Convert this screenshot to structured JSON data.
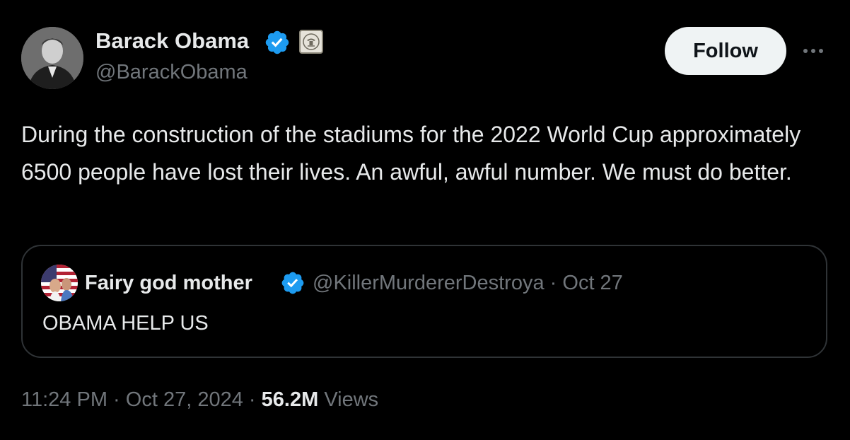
{
  "author": {
    "display_name": "Barack Obama",
    "handle": "@BarackObama",
    "verified_badge_color": "#1d9bf0",
    "affiliation_badge": "us-government-seal-icon"
  },
  "actions": {
    "follow_label": "Follow",
    "more_icon": "more-horizontal-icon"
  },
  "tweet": {
    "text": "During the construction of the stadiums for the 2022 World Cup approximately 6500 people have lost their lives. An awful, awful number. We must do better."
  },
  "quoted_tweet": {
    "display_name": "Fairy god mother",
    "handle": "@KillerMurdererDestroya",
    "separator": "·",
    "date": "Oct 27",
    "text": "OBAMA HELP US"
  },
  "meta": {
    "time": "11:24 PM",
    "separator": "·",
    "date": "Oct 27, 2024",
    "views_count": "56.2M",
    "views_label": "Views"
  },
  "colors": {
    "background": "#000000",
    "text_primary": "#e7e9ea",
    "text_secondary": "#71767b",
    "border": "#2f3336",
    "button_bg": "#eff3f4"
  }
}
